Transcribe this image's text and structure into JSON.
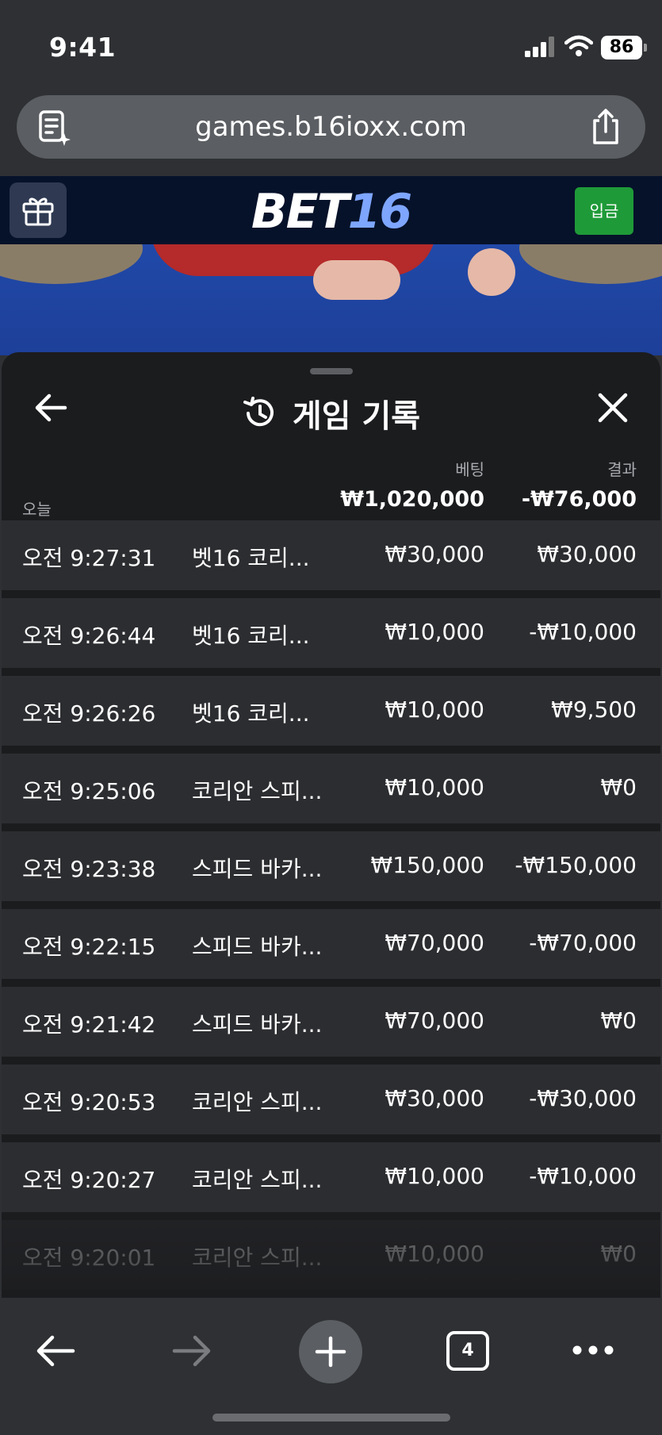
{
  "status": {
    "time": "9:41",
    "battery": "86"
  },
  "browser": {
    "url": "games.b16ioxx.com",
    "tab_count": "4"
  },
  "site": {
    "logo_part1": "BET",
    "logo_part2": "16",
    "deposit_label": "입금"
  },
  "sheet": {
    "title": "게임 기록",
    "bet_label": "베팅",
    "result_label": "결과",
    "period_label": "오늘",
    "total_bet": "₩1,020,000",
    "total_result": "-₩76,000"
  },
  "history": [
    {
      "time": "오전 9:27:31",
      "game": "벳16 코리...",
      "bet": "₩30,000",
      "result": "₩30,000"
    },
    {
      "time": "오전 9:26:44",
      "game": "벳16 코리...",
      "bet": "₩10,000",
      "result": "-₩10,000"
    },
    {
      "time": "오전 9:26:26",
      "game": "벳16 코리...",
      "bet": "₩10,000",
      "result": "₩9,500"
    },
    {
      "time": "오전 9:25:06",
      "game": "코리안 스피...",
      "bet": "₩10,000",
      "result": "₩0"
    },
    {
      "time": "오전 9:23:38",
      "game": "스피드 바카...",
      "bet": "₩150,000",
      "result": "-₩150,000"
    },
    {
      "time": "오전 9:22:15",
      "game": "스피드 바카...",
      "bet": "₩70,000",
      "result": "-₩70,000"
    },
    {
      "time": "오전 9:21:42",
      "game": "스피드 바카...",
      "bet": "₩70,000",
      "result": "₩0"
    },
    {
      "time": "오전 9:20:53",
      "game": "코리안 스피...",
      "bet": "₩30,000",
      "result": "-₩30,000"
    },
    {
      "time": "오전 9:20:27",
      "game": "코리안 스피...",
      "bet": "₩10,000",
      "result": "-₩10,000"
    },
    {
      "time": "오전 9:20:01",
      "game": "코리안 스피...",
      "bet": "₩10,000",
      "result": "₩0"
    }
  ],
  "colors": {
    "deposit": "#1f9a38",
    "logo_accent": "#7ea6ff",
    "sheet_bg": "#1b1c1e",
    "row_bg": "#2c2d30"
  }
}
